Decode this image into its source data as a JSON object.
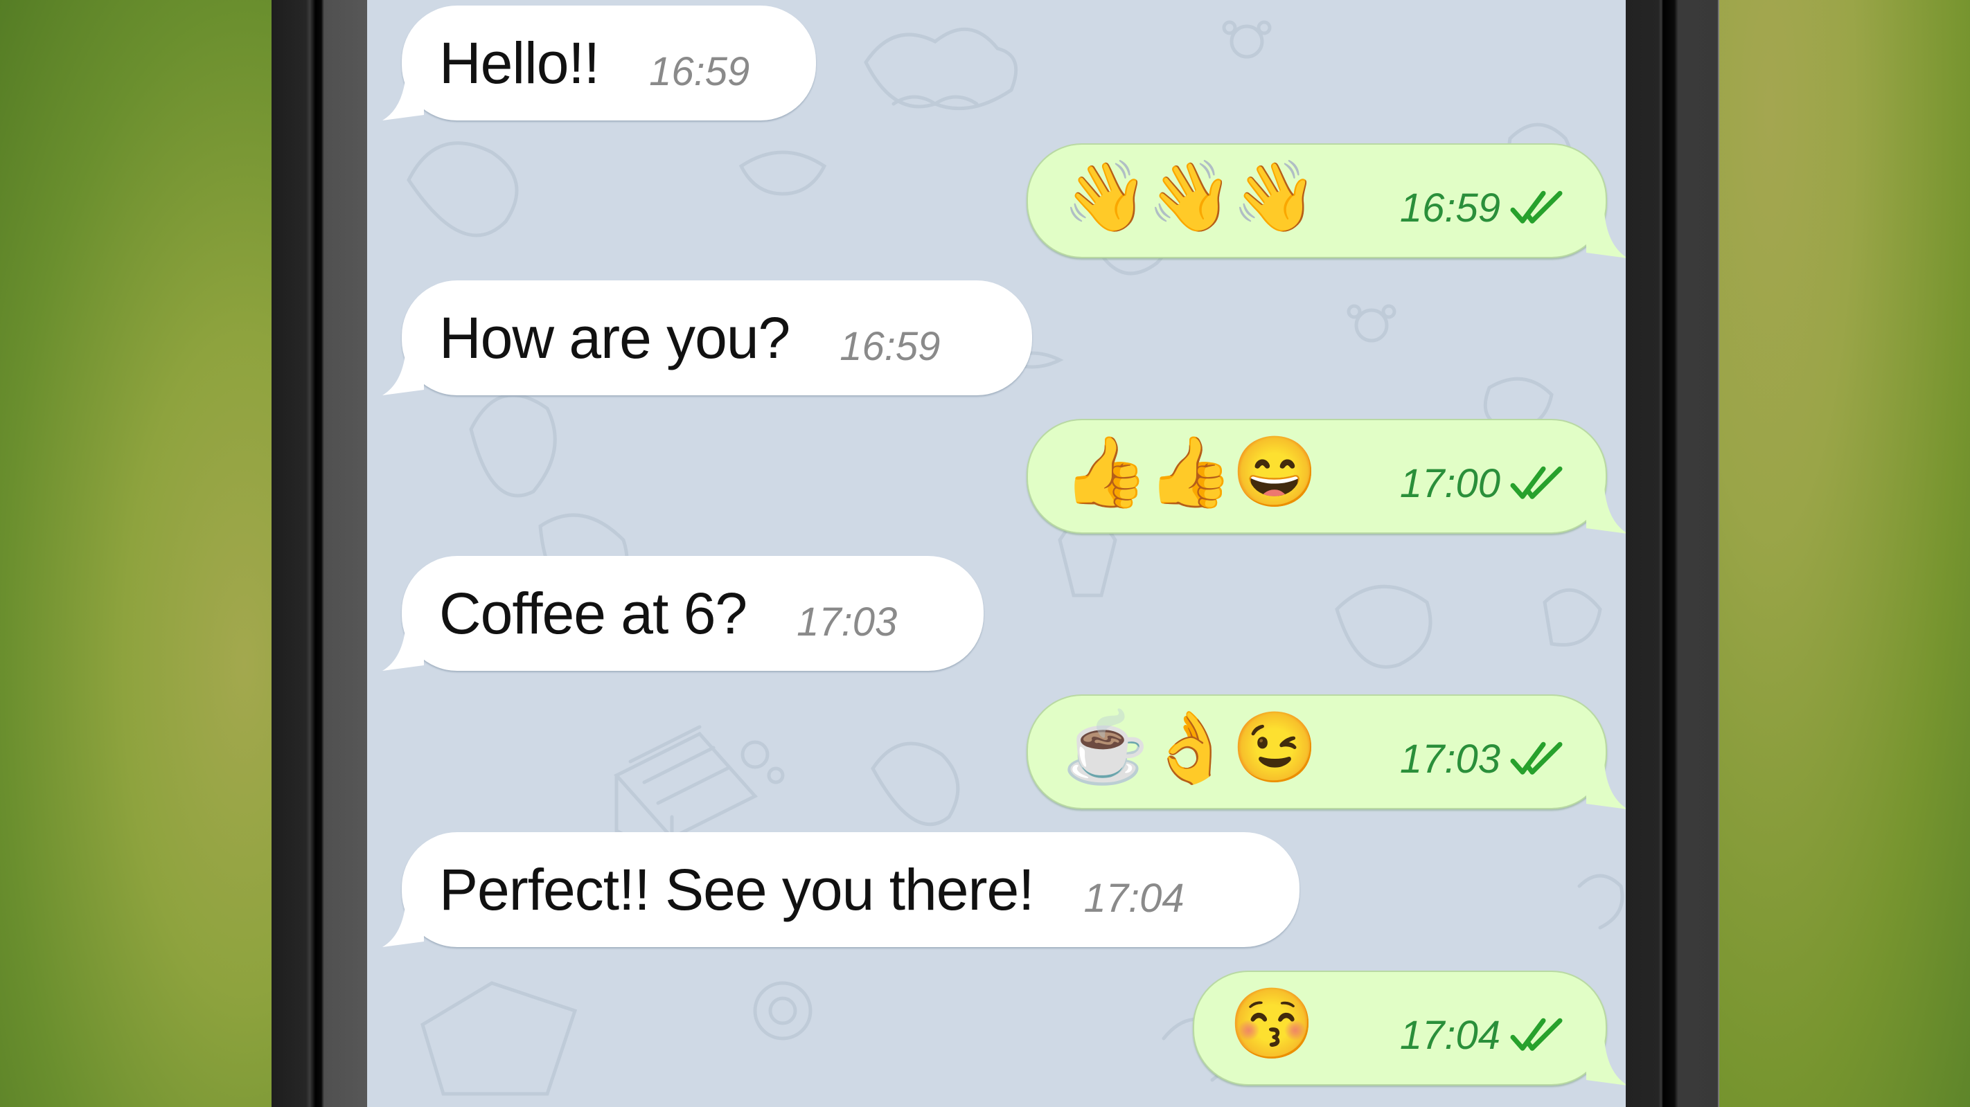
{
  "colors": {
    "incoming_bubble": "#ffffff",
    "outgoing_bubble": "#e1fec6",
    "outgoing_time": "#2a8f3a",
    "read_check": "#27a12c",
    "incoming_time": "#8a8a8a",
    "chat_background": "#cfd9e5"
  },
  "messages": [
    {
      "direction": "incoming",
      "text": "Hello!!",
      "time": "16:59"
    },
    {
      "direction": "outgoing",
      "emojis": [
        "waving-hand",
        "waving-hand",
        "waving-hand"
      ],
      "emoji_chars": [
        "👋",
        "👋",
        "👋"
      ],
      "time": "16:59",
      "status": "read"
    },
    {
      "direction": "incoming",
      "text": "How are you?",
      "time": "16:59"
    },
    {
      "direction": "outgoing",
      "emojis": [
        "thumbs-up",
        "thumbs-up",
        "grinning-face"
      ],
      "emoji_chars": [
        "👍",
        "👍",
        "😄"
      ],
      "time": "17:00",
      "status": "read"
    },
    {
      "direction": "incoming",
      "text": "Coffee at 6?",
      "time": "17:03"
    },
    {
      "direction": "outgoing",
      "emojis": [
        "hot-coffee",
        "ok-hand",
        "winking-face"
      ],
      "emoji_chars": [
        "☕",
        "👌",
        "😉"
      ],
      "time": "17:03",
      "status": "read"
    },
    {
      "direction": "incoming",
      "text": "Perfect!! See you there!",
      "time": "17:04"
    },
    {
      "direction": "outgoing",
      "emojis": [
        "kissing-face-closed-eyes"
      ],
      "emoji_chars": [
        "😚"
      ],
      "time": "17:04",
      "status": "read"
    }
  ]
}
